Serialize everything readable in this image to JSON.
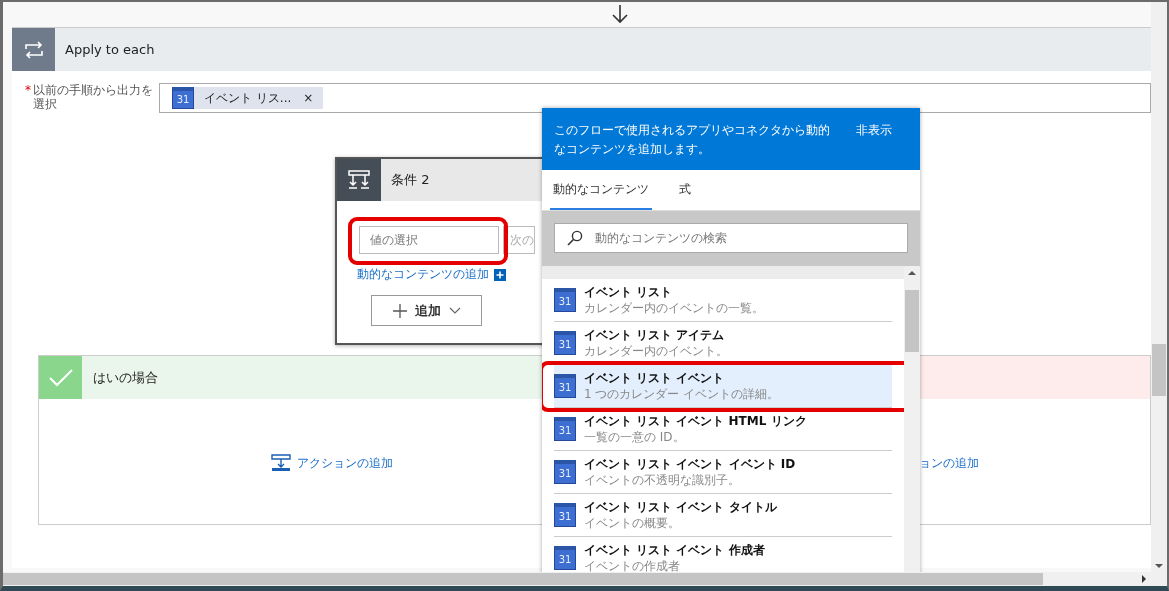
{
  "apply_to_each": {
    "title": "Apply to each",
    "select_output": {
      "required_mark": "*",
      "label": "以前の手順から出力を選択",
      "token": {
        "icon": "31",
        "text": "イベント リス...",
        "remove": "×"
      }
    }
  },
  "condition": {
    "title": "条件 2",
    "value_field": {
      "placeholder": "値の選択",
      "highlighted": true
    },
    "next_field": {
      "placeholder": "次の"
    },
    "dynamic_link": "動的なコンテンツの追加",
    "add_button": "追加"
  },
  "yes_branch": {
    "title": "はいの場合",
    "add_action": "アクションの追加"
  },
  "no_branch": {
    "add_action": "ョンの追加"
  },
  "dynamic_panel": {
    "description": "このフローで使用されるアプリやコネクタから動的なコンテンツを追加します。",
    "hide": "非表示",
    "tabs": [
      {
        "label": "動的なコンテンツ",
        "selected": true
      },
      {
        "label": "式",
        "selected": false
      }
    ],
    "search": {
      "placeholder": "動的なコンテンツの検索"
    },
    "items": [
      {
        "icon": "31",
        "title": "イベント リスト",
        "description": "カレンダー内のイベントの一覧。",
        "selected": false,
        "highlighted": false
      },
      {
        "icon": "31",
        "title": "イベント リスト アイテム",
        "description": "カレンダー内のイベント。",
        "selected": false,
        "highlighted": false
      },
      {
        "icon": "31",
        "title": "イベント リスト イベント",
        "description": "1 つのカレンダー イベントの詳細。",
        "selected": true,
        "highlighted": true
      },
      {
        "icon": "31",
        "title": "イベント リスト イベント HTML リンク",
        "description": "一覧の一意の ID。",
        "selected": false,
        "highlighted": false
      },
      {
        "icon": "31",
        "title": "イベント リスト イベント イベント ID",
        "description": "イベントの不透明な識別子。",
        "selected": false,
        "highlighted": false
      },
      {
        "icon": "31",
        "title": "イベント リスト イベント タイトル",
        "description": "イベントの概要。",
        "selected": false,
        "highlighted": false
      },
      {
        "icon": "31",
        "title": "イベント リスト イベント 作成者",
        "description": "イベントの作成者",
        "selected": false,
        "highlighted": false
      }
    ]
  }
}
